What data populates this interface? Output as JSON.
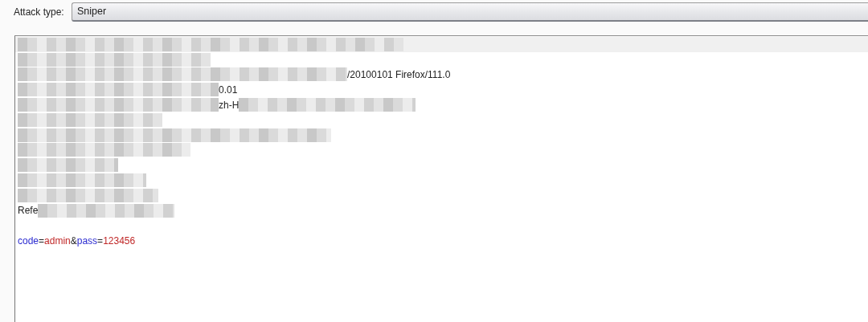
{
  "attack_type": {
    "label": "Attack type:",
    "value": "Sniper"
  },
  "request_editor": {
    "lines": [
      {
        "kind": "redacted"
      },
      {
        "kind": "redacted"
      },
      {
        "kind": "tail",
        "text": "/20100101 Firefox/111.0"
      },
      {
        "kind": "tail",
        "text": "0.01"
      },
      {
        "kind": "middle",
        "text": "zh-H"
      },
      {
        "kind": "redacted"
      },
      {
        "kind": "redacted"
      },
      {
        "kind": "redacted"
      },
      {
        "kind": "redacted"
      },
      {
        "kind": "redacted"
      },
      {
        "kind": "redacted"
      },
      {
        "kind": "head",
        "text": "Refe"
      },
      {
        "kind": "blank"
      },
      {
        "kind": "body",
        "tokens": [
          {
            "kind": "name",
            "text": "code"
          },
          {
            "kind": "sep",
            "text": "="
          },
          {
            "kind": "value",
            "text": "admin"
          },
          {
            "kind": "sep",
            "text": "&"
          },
          {
            "kind": "name",
            "text": "pass"
          },
          {
            "kind": "sep",
            "text": "="
          },
          {
            "kind": "value",
            "text": "123456"
          }
        ]
      }
    ]
  }
}
